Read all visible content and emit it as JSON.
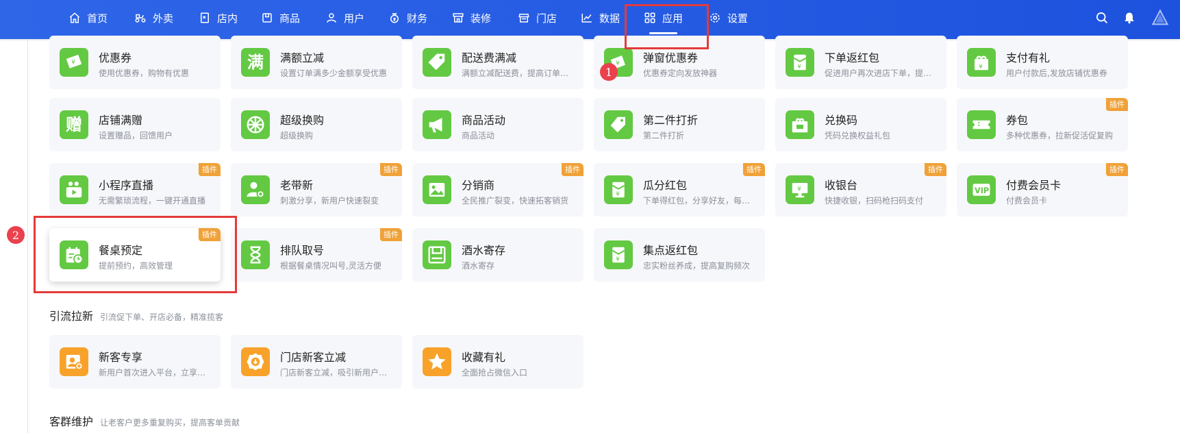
{
  "nav": {
    "items": [
      {
        "label": "首页",
        "icon": "home-icon"
      },
      {
        "label": "外卖",
        "icon": "scooter-icon"
      },
      {
        "label": "店内",
        "icon": "qr-table-icon"
      },
      {
        "label": "商品",
        "icon": "box-icon"
      },
      {
        "label": "用户",
        "icon": "user-icon"
      },
      {
        "label": "财务",
        "icon": "money-bag-icon"
      },
      {
        "label": "装修",
        "icon": "shop-decor-icon"
      },
      {
        "label": "门店",
        "icon": "store-icon"
      },
      {
        "label": "数据",
        "icon": "chart-line-icon"
      },
      {
        "label": "应用",
        "icon": "apps-grid-icon",
        "active": true
      },
      {
        "label": "设置",
        "icon": "gear-icon"
      }
    ]
  },
  "cards": [
    {
      "title": "优惠券",
      "desc": "使用优惠券，购物有优惠",
      "icon": "coupon-icon"
    },
    {
      "title": "满额立减",
      "desc": "设置订单满多少金额享受优惠",
      "icon": "full-reduce-icon"
    },
    {
      "title": "配送费满减",
      "desc": "满额立减配送费，提高订单流量",
      "icon": "delivery-tag-icon"
    },
    {
      "title": "弹窗优惠券",
      "desc": "优惠券定向发放神器",
      "icon": "popup-coupon-icon"
    },
    {
      "title": "下单返红包",
      "desc": "促进用户再次进店下单，提升复购",
      "icon": "red-envelope-icon"
    },
    {
      "title": "支付有礼",
      "desc": "用户付款后,发放店铺优惠券",
      "icon": "gift-pay-icon"
    },
    {
      "title": "店铺满赠",
      "desc": "设置赠品，回馈用户",
      "icon": "gift-char-icon"
    },
    {
      "title": "超级换购",
      "desc": "超级换购",
      "icon": "wheel-icon"
    },
    {
      "title": "商品活动",
      "desc": "商品活动",
      "icon": "megaphone-icon"
    },
    {
      "title": "第二件打折",
      "desc": "第二件打折",
      "icon": "price-tag-icon"
    },
    {
      "title": "兑换码",
      "desc": "凭码兑换权益礼包",
      "icon": "gift-box-icon"
    },
    {
      "title": "券包",
      "desc": "多种优惠券，拉新促活促复购",
      "icon": "ticket-icon",
      "tag": "插件"
    },
    {
      "title": "小程序直播",
      "desc": "无需繁琐流程，一键开通直播",
      "icon": "live-camera-icon",
      "tag": "插件"
    },
    {
      "title": "老带新",
      "desc": "刺激分享，新用户快速裂变",
      "icon": "user-add-icon",
      "tag": "插件"
    },
    {
      "title": "分销商",
      "desc": "全民推广裂变，快速拓客销货",
      "icon": "image-icon",
      "tag": "插件"
    },
    {
      "title": "瓜分红包",
      "desc": "下单得红包，分享好友，每人都有",
      "icon": "red-envelope-icon",
      "tag": "插件"
    },
    {
      "title": "收银台",
      "desc": "快捷收银，扫码枪扫码支付",
      "icon": "cashier-icon",
      "tag": "插件"
    },
    {
      "title": "付费会员卡",
      "desc": "付费会员卡",
      "icon": "vip-card-icon",
      "tag": "插件"
    },
    {
      "title": "餐桌预定",
      "desc": "提前预约，高效管理",
      "icon": "calendar-clock-icon",
      "tag": "插件"
    },
    {
      "title": "排队取号",
      "desc": "根据餐桌情况叫号,灵活方便",
      "icon": "hourglass-icon",
      "tag": "插件"
    },
    {
      "title": "酒水寄存",
      "desc": "酒水寄存",
      "icon": "storage-box-icon"
    },
    {
      "title": "集点返红包",
      "desc": "忠实粉丝养成，提高复购频次",
      "icon": "red-envelope-icon"
    }
  ],
  "sections": [
    {
      "title": "引流拉新",
      "sub": "引流促下单、开店必备，精准揽客"
    },
    {
      "title": "客群维护",
      "sub": "让老客户更多重复购买，提高客单贡献"
    }
  ],
  "traffic_cards": [
    {
      "title": "新客专享",
      "desc": "新用户首次进入平台，立享好礼",
      "icon": "new-customer-icon"
    },
    {
      "title": "门店新客立减",
      "desc": "门店新客立减，吸引新用户下单",
      "icon": "download-badge-icon"
    },
    {
      "title": "收藏有礼",
      "desc": "全面抢占微信入口",
      "icon": "star-icon"
    }
  ],
  "markers": [
    "1",
    "2"
  ]
}
